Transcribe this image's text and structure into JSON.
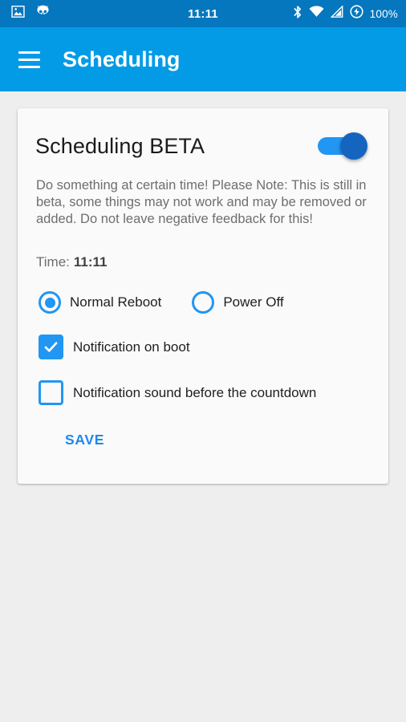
{
  "status_bar": {
    "time": "11:11",
    "battery_percent": "100%",
    "left_icons": [
      "image-icon",
      "cyanogenmod-icon"
    ],
    "right_icons": [
      "bluetooth-icon",
      "wifi-icon",
      "cell-signal-icon",
      "battery-charging-icon"
    ],
    "background_color": "#0477be"
  },
  "app_bar": {
    "menu_icon": "hamburger-menu-icon",
    "title": "Scheduling",
    "background_color": "#039be5"
  },
  "card": {
    "title": "Scheduling BETA",
    "toggle": {
      "state": "on",
      "track_color": "#2196f3",
      "thumb_color": "#1565c0"
    },
    "description": "Do something at certain time!\nPlease Note: This is still in beta, some things may not work and may be removed or added. Do not leave negative feedback for this!",
    "time_label": "Time:",
    "time_value": "11:11",
    "radios": [
      {
        "label": "Normal Reboot",
        "selected": true
      },
      {
        "label": "Power Off",
        "selected": false
      }
    ],
    "checkboxes": [
      {
        "label": "Notification on boot",
        "checked": true
      },
      {
        "label": "Notification sound before the countdown",
        "checked": false
      }
    ],
    "save_label": "SAVE",
    "accent_color": "#2196f3",
    "background_color": "#fafafa"
  },
  "page": {
    "background_color": "#eeeeee"
  }
}
